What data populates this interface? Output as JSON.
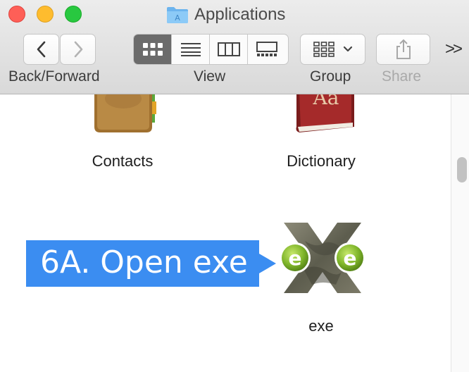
{
  "window": {
    "title": "Applications"
  },
  "toolbar": {
    "back_forward_label": "Back/Forward",
    "view_label": "View",
    "group_label": "Group",
    "share_label": "Share",
    "active_view": "icon",
    "overflow_glyph": ">>"
  },
  "items": [
    {
      "label": "Contacts",
      "icon": "contacts-app-icon"
    },
    {
      "label": "Dictionary",
      "icon": "dictionary-app-icon"
    },
    {
      "label": "exe",
      "icon": "exe-app-icon"
    }
  ],
  "callout": {
    "text": "6A. Open exe",
    "color": "#3b8df1"
  },
  "dictionary_icon_text": "Aa"
}
